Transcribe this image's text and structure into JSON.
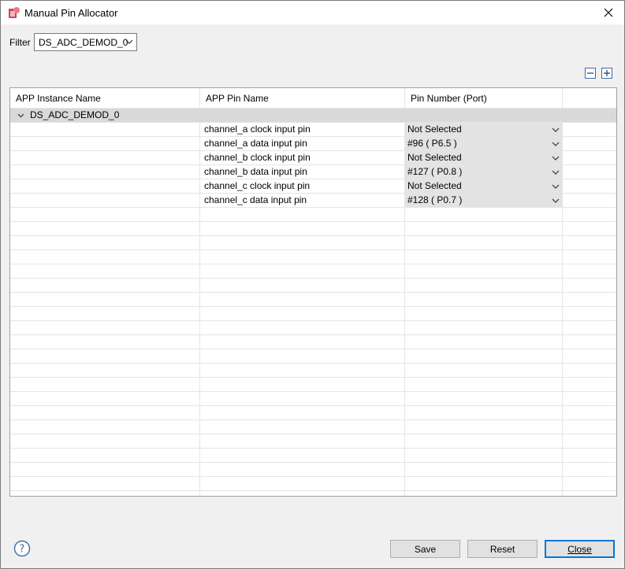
{
  "window": {
    "title": "Manual Pin Allocator"
  },
  "filter": {
    "label": "Filter",
    "value": "DS_ADC_DEMOD_0"
  },
  "table": {
    "columns": [
      "APP Instance Name",
      "APP Pin Name",
      "Pin Number (Port)"
    ],
    "group": {
      "name": "DS_ADC_DEMOD_0"
    },
    "rows": [
      {
        "pin_name": "channel_a clock input pin",
        "pin_number": "Not Selected"
      },
      {
        "pin_name": "channel_a data input pin",
        "pin_number": "#96 ( P6.5 )"
      },
      {
        "pin_name": "channel_b clock input pin",
        "pin_number": "Not Selected"
      },
      {
        "pin_name": "channel_b data input pin",
        "pin_number": "#127 ( P0.8 )"
      },
      {
        "pin_name": "channel_c clock input pin",
        "pin_number": "Not Selected"
      },
      {
        "pin_name": "channel_c data input pin",
        "pin_number": "#128 ( P0.7 )"
      }
    ]
  },
  "buttons": {
    "save": "Save",
    "reset": "Reset",
    "close": "Close"
  },
  "icons": {
    "app": "app-icon",
    "close": "close-icon",
    "collapse_all": "collapse-all-icon",
    "expand_all": "expand-all-icon",
    "help": "help-icon",
    "chevron": "chevron-down-icon"
  },
  "colors": {
    "group_row": "#d9d9d9",
    "combo_bg": "#e3e3e3",
    "default_button_border": "#0078d7"
  }
}
